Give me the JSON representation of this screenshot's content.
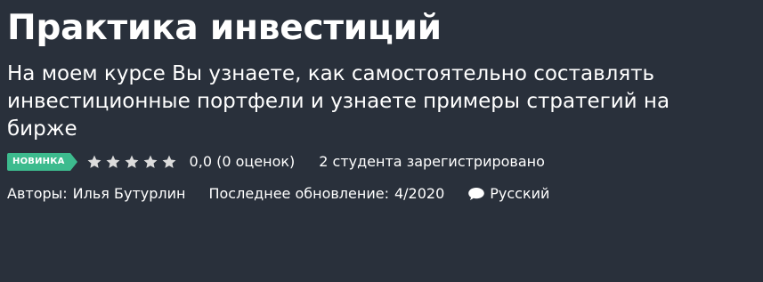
{
  "course": {
    "title": "Практика инвестиций",
    "subtitle": "На моем курсе Вы узнаете, как самостоятельно составлять инвестиционные портфели и узнаете примеры стратегий на бирже",
    "badge": "НОВИНКА",
    "rating": {
      "stars": 5,
      "filled": 0,
      "text": "0,0 (0 оценок)"
    },
    "students": "2 студента зарегистрировано",
    "authors_label": "Авторы:",
    "authors_value": "Илья Бутурлин",
    "updated_label": "Последнее обновление:",
    "updated_value": "4/2020",
    "language": "Русский",
    "icons": {
      "star": "star-icon",
      "language": "speech-bubble-icon"
    },
    "colors": {
      "background": "#29303b",
      "badge": "#3dbb8e",
      "star": "#dcdcdc",
      "text": "#ffffff"
    }
  }
}
